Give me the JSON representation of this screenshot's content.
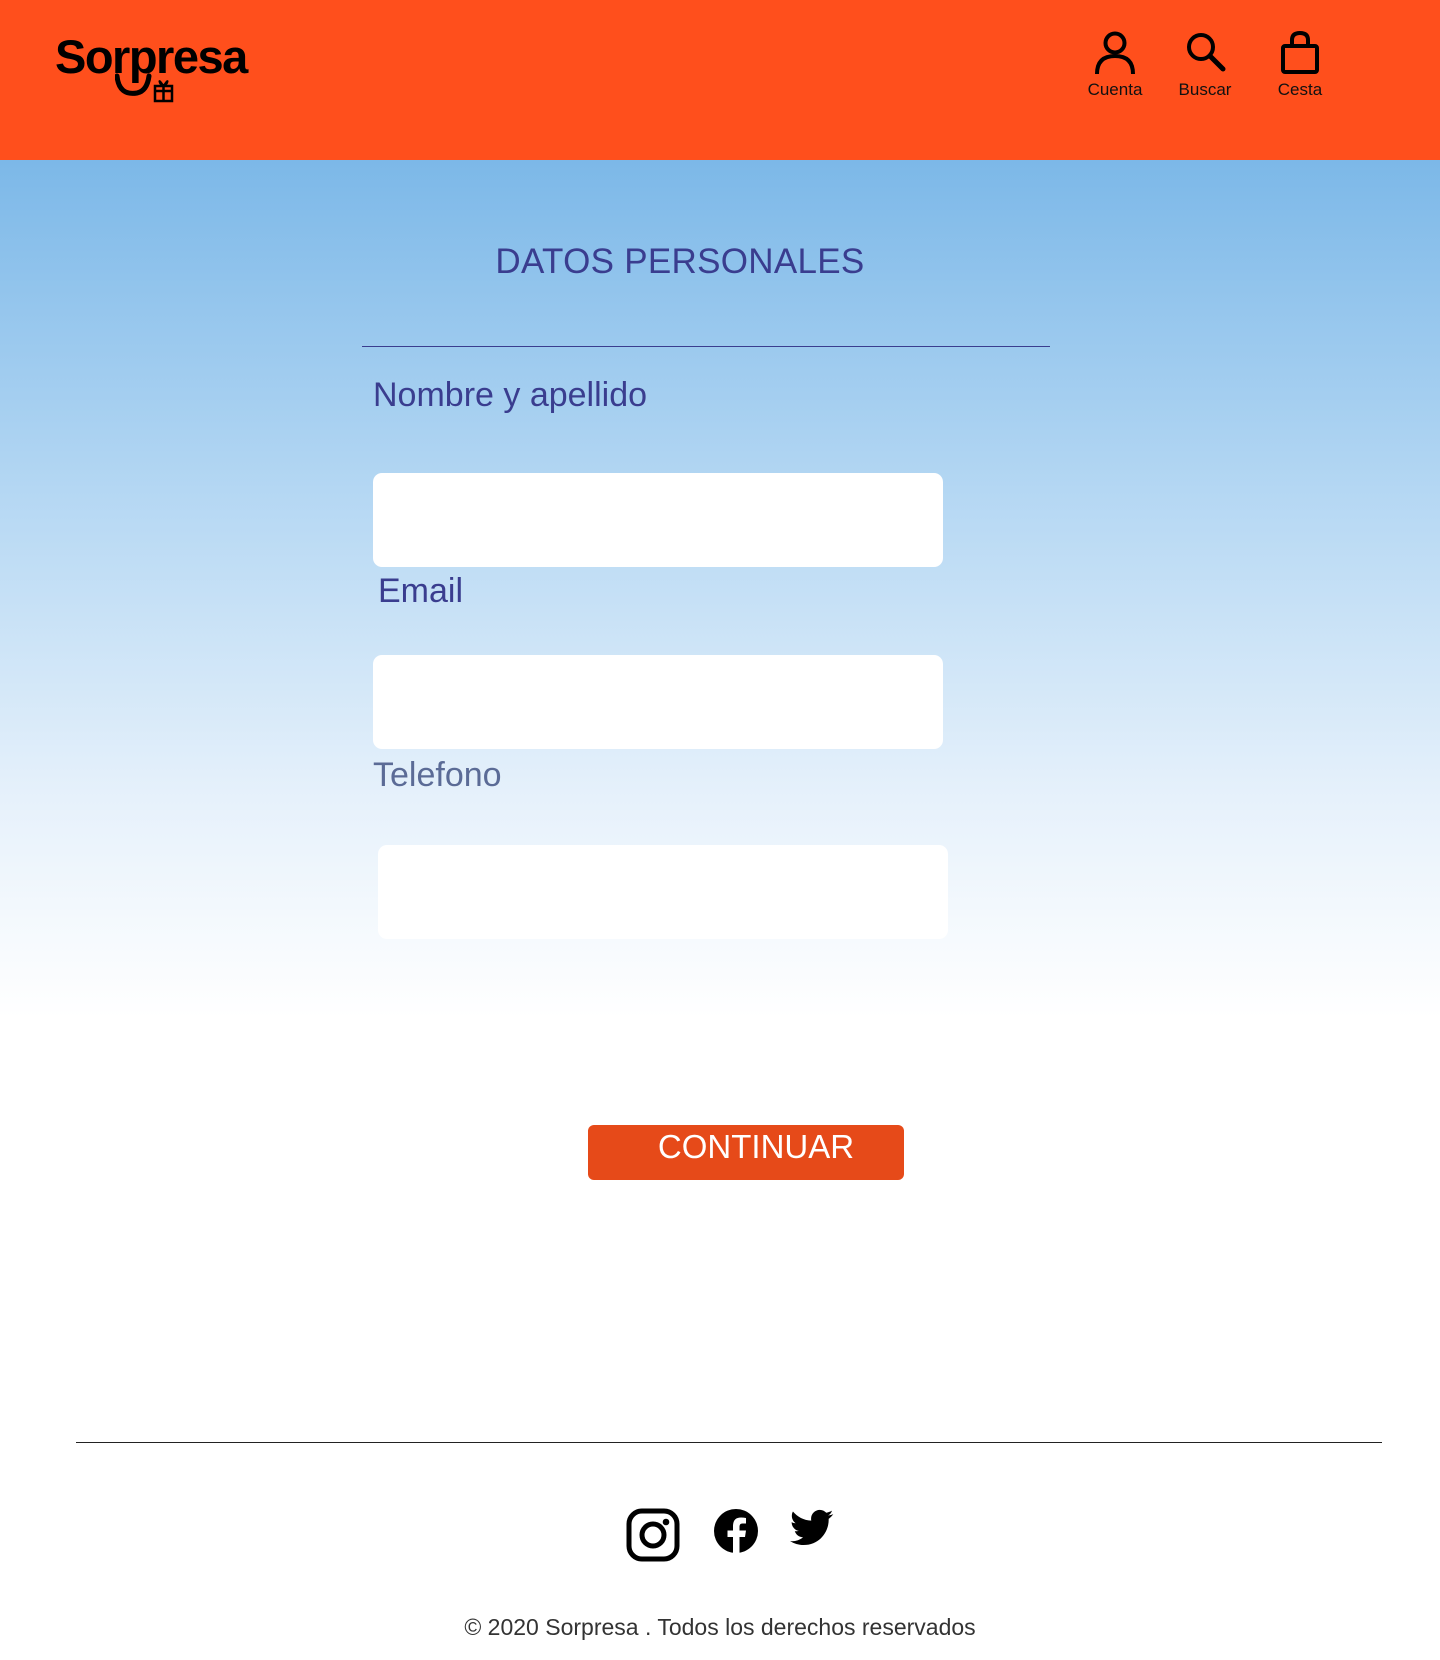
{
  "brand": {
    "name": "Sorpresa",
    "primary_color": "#ff4f1c",
    "accent_color": "#3a3d8f"
  },
  "nav": [
    {
      "label": "Cuenta",
      "icon": "user-icon"
    },
    {
      "label": "Buscar",
      "icon": "search-icon"
    },
    {
      "label": "Cesta",
      "icon": "shopping-bag-icon"
    }
  ],
  "form": {
    "title": "DATOS PERSONALES",
    "fields": [
      {
        "label": "Nombre y apellido",
        "value": "",
        "placeholder": ""
      },
      {
        "label": "Email",
        "value": "",
        "placeholder": ""
      },
      {
        "label": "Telefono",
        "value": "",
        "placeholder": ""
      }
    ],
    "submit_label": "CONTINUAR",
    "submit_color": "#e64a19"
  },
  "footer": {
    "social": [
      "instagram-icon",
      "facebook-icon",
      "twitter-icon"
    ],
    "copyright": "© 2020 Sorpresa . Todos los derechos reservados"
  }
}
